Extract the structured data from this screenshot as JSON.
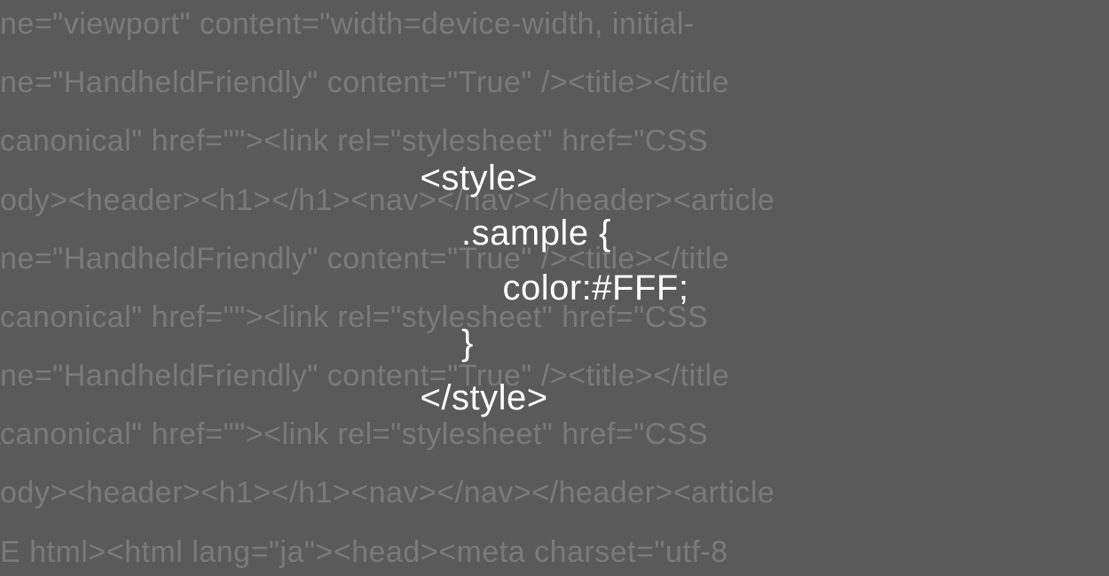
{
  "background": {
    "lines": [
      "ne=\"viewport\" content=\"width=device-width, initial-",
      "ne=\"HandheldFriendly\" content=\"True\" /><title></title",
      "canonical\" href=\"\"><link rel=\"stylesheet\" href=\"CSS",
      "ody><header><h1></h1><nav></nav></header><article",
      "ne=\"HandheldFriendly\" content=\"True\" /><title></title",
      "canonical\" href=\"\"><link rel=\"stylesheet\" href=\"CSS",
      "ne=\"HandheldFriendly\" content=\"True\" /><title></title",
      "canonical\" href=\"\"><link rel=\"stylesheet\" href=\"CSS",
      "ody><header><h1></h1><nav></nav></header><article",
      "E html><html lang=\"ja\"><head><meta charset=\"utf-8"
    ]
  },
  "foreground": {
    "lines": [
      "<style>",
      "    .sample {",
      "        color:#FFF;",
      "    }",
      "</style>"
    ]
  }
}
